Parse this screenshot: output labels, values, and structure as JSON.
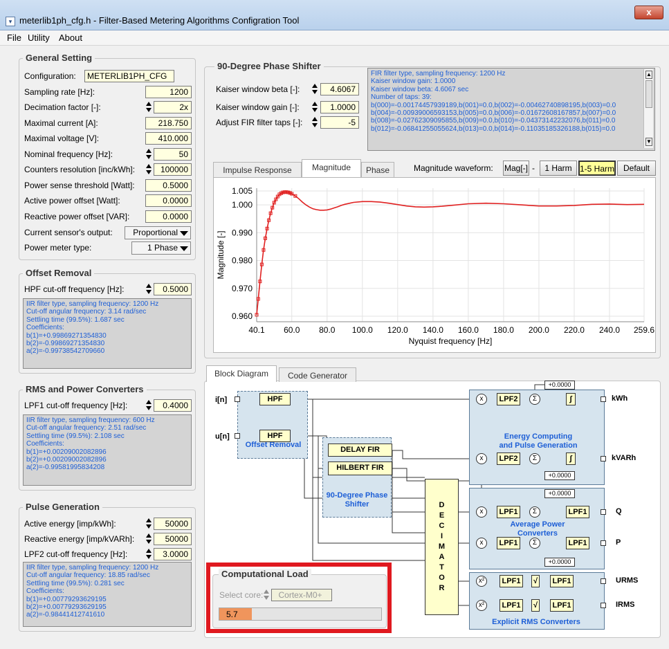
{
  "window": {
    "title": "meterlib1ph_cfg.h - Filter-Based Metering Algorithms Configration Tool",
    "close": "x",
    "app_icon": "window-app-icon"
  },
  "menu": [
    "File",
    "Utility",
    "About"
  ],
  "general": {
    "title": "General Setting",
    "rows": [
      {
        "label": "Configuration:",
        "value": "METERLIB1PH_CFG"
      },
      {
        "label": "Sampling rate [Hz]:",
        "value": "1200"
      },
      {
        "label": "Decimation factor [-]:",
        "value": "2x"
      },
      {
        "label": "Maximal current [A]:",
        "value": "218.750"
      },
      {
        "label": "Maximal voltage [V]:",
        "value": "410.000"
      },
      {
        "label": "Nominal frequency [Hz]:",
        "value": "50"
      },
      {
        "label": "Counters resolution [inc/kWh]:",
        "value": "100000"
      },
      {
        "label": "Power sense threshold [Watt]:",
        "value": "0.5000"
      },
      {
        "label": "Active power offset [Watt]:",
        "value": "0.0000"
      },
      {
        "label": "Reactive power offset [VAR]:",
        "value": "0.0000"
      },
      {
        "label": "Current sensor's output:",
        "value": "Proportional"
      },
      {
        "label": "Power meter type:",
        "value": "1 Phase"
      }
    ]
  },
  "offset": {
    "title": "Offset Removal",
    "label": "HPF cut-off frequency [Hz]:",
    "value": "0.5000",
    "info": [
      "IIR filter type, sampling frequency: 1200 Hz",
      "Cut-off angular frequency:   3.14 rad/sec",
      "Settling time (99.5%): 1.687 sec",
      "Coefficients:",
      "b(1)=+0.99869271354830",
      "b(2)=-0.99869271354830",
      "a(2)=-0.99738542709660"
    ]
  },
  "rms": {
    "title": "RMS and Power Converters",
    "label": "LPF1 cut-off frequency [Hz]:",
    "value": "0.4000",
    "info": [
      "IIR filter type, sampling frequency: 600 Hz",
      "Cut-off angular frequency:   2.51 rad/sec",
      "Settling time (99.5%): 2.108 sec",
      "Coefficients:",
      "b(1)=+0.00209002082896",
      "b(2)=+0.00209002082896",
      "a(2)=-0.99581995834208"
    ]
  },
  "pulse": {
    "title": "Pulse Generation",
    "rows": [
      {
        "label": "Active energy [imp/kWh]:",
        "value": "50000"
      },
      {
        "label": "Reactive energy [imp/kVARh]:",
        "value": "50000"
      },
      {
        "label": "LPF2 cut-off frequency [Hz]:",
        "value": "3.0000"
      }
    ],
    "info": [
      "IIR filter type, sampling frequency: 1200 Hz",
      "Cut-off angular frequency:  18.85 rad/sec",
      "Settling time (99.5%): 0.281 sec",
      "Coefficients:",
      "b(1)=+0.00779293629195",
      "b(2)=+0.00779293629195",
      "a(2)=-0.98441412741610"
    ]
  },
  "shifter": {
    "title": "90-Degree Phase Shifter",
    "rows": [
      {
        "label": "Kaiser window beta [-]:",
        "value": "4.6067"
      },
      {
        "label": "Kaiser window gain [-]:",
        "value": "1.0000"
      },
      {
        "label": "Adjust FIR filter taps [-]:",
        "value": "-5"
      }
    ],
    "info": [
      "FIR filter type, sampling frequency: 1200 Hz",
      "Kaiser window gain: 1.0000",
      "Kaiser window beta: 4.6067 sec",
      "Number of taps:  39:",
      "b(000)=-0.00174457939189,b(001)=0.0,b(002)=-0.00462740898195,b(003)=0.0",
      "b(004)=-0.00939006593153,b(005)=0.0,b(006)=-0.01672608167857,b(007)=0.0",
      "b(008)=-0.02762309095855,b(009)=0.0,b(010)=-0.04373142232076,b(011)=0.0",
      "b(012)=-0.06841255055624,b(013)=0.0,b(014)=-0.11035185326188,b(015)=0.0"
    ]
  },
  "chart_tabs": [
    "Impulse Response",
    "Magnitude",
    "Phase"
  ],
  "waveform": {
    "label": "Magnitude waveform:",
    "buttons": [
      "Mag[-]",
      "-",
      "1 Harm",
      "1-5 Harm",
      "Default"
    ]
  },
  "chart_data": {
    "type": "line",
    "xlabel": "Nyquist frequency [Hz]",
    "ylabel": "Magnitude [-]",
    "xlim": [
      40.1,
      259.6
    ],
    "ylim": [
      0.958,
      1.006
    ],
    "xticks": [
      "40.1",
      "60.0",
      "80.0",
      "100.0",
      "120.0",
      "140.0",
      "160.0",
      "180.0",
      "200.0",
      "220.0",
      "240.0",
      "259.6"
    ],
    "xtick_values": [
      40.1,
      60,
      80,
      100,
      120,
      140,
      160,
      180,
      200,
      220,
      240,
      259.6
    ],
    "yticks": [
      "1.005",
      "1.000",
      "0.990",
      "0.980",
      "0.970",
      "0.960"
    ],
    "ytick_values": [
      1.005,
      1.0,
      0.99,
      0.98,
      0.97,
      0.96
    ],
    "color": "#e02020",
    "series": [
      {
        "x": [
          40.1,
          41,
          42,
          43,
          44,
          45,
          46,
          47,
          48,
          49,
          50,
          51,
          52,
          53,
          54,
          55,
          56,
          57,
          58,
          59,
          60,
          62,
          64,
          66,
          68,
          70,
          72,
          74,
          76,
          78,
          80,
          82,
          84,
          86,
          88,
          90,
          95,
          100,
          105,
          110,
          115,
          120,
          125,
          130,
          135,
          140,
          145,
          150,
          160,
          170,
          180,
          190,
          200,
          210,
          220,
          230,
          240,
          250,
          259.6
        ],
        "y": [
          0.9605,
          0.9662,
          0.9725,
          0.9786,
          0.9838,
          0.988,
          0.9915,
          0.9945,
          0.997,
          0.999,
          1.0008,
          1.002,
          1.003,
          1.0038,
          1.0042,
          1.0045,
          1.0046,
          1.0046,
          1.0045,
          1.0043,
          1.004,
          1.0032,
          1.0022,
          1.001,
          1.0,
          0.9992,
          0.9986,
          0.9983,
          0.9981,
          0.9981,
          0.9982,
          0.9985,
          0.9989,
          0.9993,
          0.9998,
          1.0002,
          1.0009,
          1.0012,
          1.0012,
          1.001,
          1.0006,
          1.0001,
          0.9996,
          0.9993,
          0.9992,
          0.9993,
          0.9995,
          0.9998,
          1.0004,
          1.0006,
          1.0004,
          1.0,
          0.9996,
          0.9996,
          0.9998,
          1.0002,
          1.0003,
          1.0001,
          1.0002
        ]
      }
    ]
  },
  "lower_tabs": [
    "Block Diagram",
    "Code Generator"
  ],
  "diagram": {
    "in_i": "i[n]",
    "in_u": "u[n]",
    "hpf": "HPF",
    "offset_zone": "Offset Removal",
    "delay_fir": "DELAY FIR",
    "hilbert_fir": "HILBERT FIR",
    "shifter_zone": "90-Degree Phase Shifter",
    "decimator": [
      "D",
      "E",
      "C",
      "I",
      "M",
      "A",
      "T",
      "O",
      "R"
    ],
    "energy_zone": "Energy Computing and Pulse Generation",
    "avg_zone": "Average Power Converters",
    "rms_zone": "Explicit RMS Converters",
    "lpf1": "LPF1",
    "lpf2": "LPF2",
    "offset_val": "+0.0000",
    "mult": "x",
    "sum": "Σ",
    "integ": "∫",
    "sq": "x²",
    "sqrt": "√",
    "outputs": [
      "kWh",
      "kVARh",
      "Q",
      "P",
      "URMS",
      "IRMS"
    ]
  },
  "load": {
    "title": "Computational Load",
    "core_label": "Select core:",
    "core_value": "Cortex-M0+",
    "value": "5.7",
    "progress": 0.04,
    "highlight": "#e0191f"
  }
}
